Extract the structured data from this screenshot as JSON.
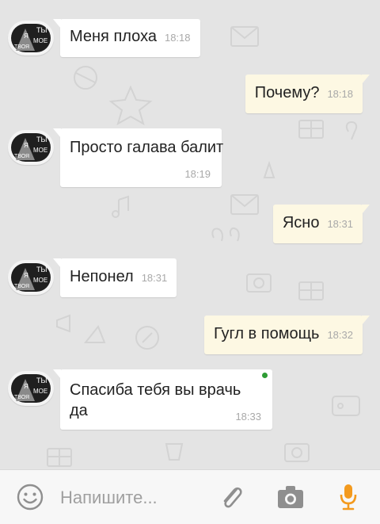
{
  "messages": [
    {
      "dir": "in",
      "text": "Меня плоха",
      "time": "18:18"
    },
    {
      "dir": "out",
      "text": "Почему?",
      "time": "18:18"
    },
    {
      "dir": "in",
      "text": "Просто галава балит",
      "time": "18:19"
    },
    {
      "dir": "out",
      "text": "Ясно",
      "time": "18:31"
    },
    {
      "dir": "in",
      "text": "Непонел",
      "time": "18:31"
    },
    {
      "dir": "out",
      "text": "Гугл в помощь",
      "time": "18:32"
    },
    {
      "dir": "in",
      "text_line1": "Спасиба тебя вы врачь",
      "text_line2": "да",
      "time": "18:33"
    }
  ],
  "avatar": {
    "line1": "ТЫ",
    "line2": "Я",
    "line3": "МОЕ",
    "line4": "ТВОЯ"
  },
  "input": {
    "placeholder": "Напишите..."
  },
  "icons": {
    "emoji": "smiley-icon",
    "attach": "paperclip-icon",
    "camera": "camera-icon",
    "mic": "microphone-icon"
  },
  "colors": {
    "mic": "#f39a1e",
    "online": "#2e9c34",
    "outgoing_bubble": "#fdf8e3"
  }
}
